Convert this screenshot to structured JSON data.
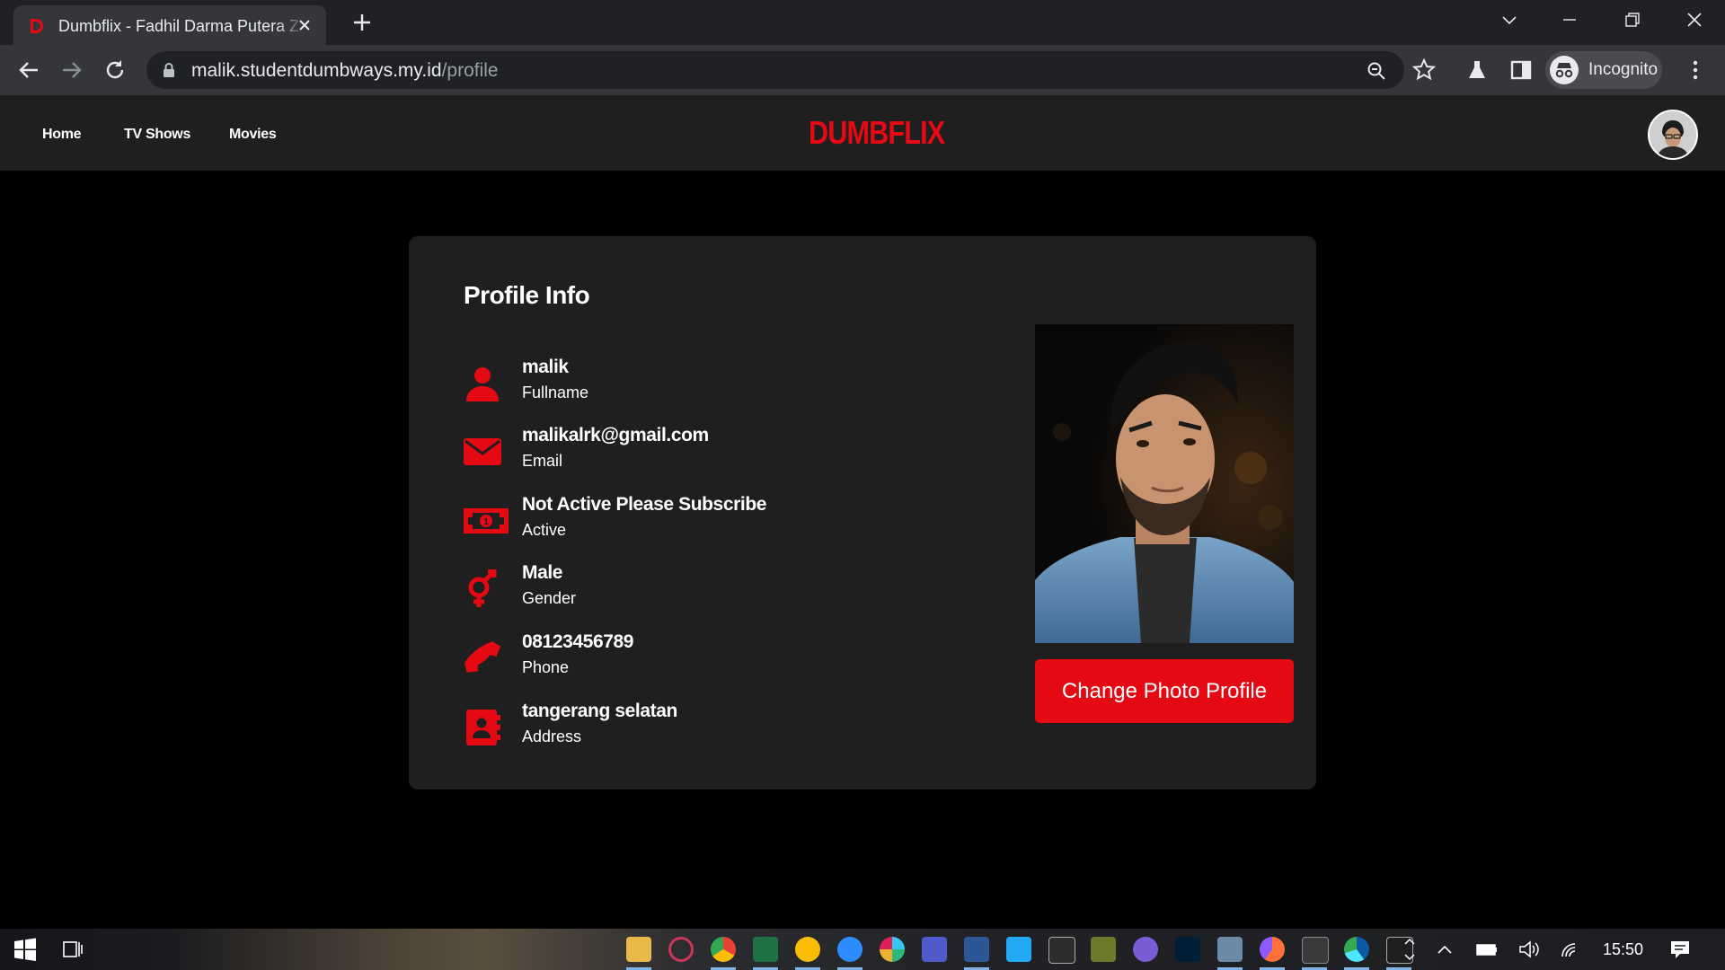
{
  "browser": {
    "tab_title": "Dumbflix - Fadhil Darma Putera Z",
    "url_host": "malik.studentdumbways.my.id",
    "url_path": "/profile",
    "profile_label": "Incognito"
  },
  "site": {
    "logo": "DUMBFLIX",
    "nav": [
      "Home",
      "TV Shows",
      "Movies"
    ],
    "brand_color": "#e50914"
  },
  "profile": {
    "title": "Profile Info",
    "fields": [
      {
        "icon": "user-icon",
        "value": "malik",
        "label": "Fullname"
      },
      {
        "icon": "envelope-icon",
        "value": "malikalrk@gmail.com",
        "label": "Email"
      },
      {
        "icon": "money-bill-icon",
        "value": "Not Active Please Subscribe",
        "label": "Active"
      },
      {
        "icon": "gender-icon",
        "value": "Male",
        "label": "Gender"
      },
      {
        "icon": "phone-icon",
        "value": "08123456789",
        "label": "Phone"
      },
      {
        "icon": "address-book-icon",
        "value": "tangerang selatan",
        "label": "Address"
      }
    ],
    "change_photo_label": "Change Photo Profile"
  },
  "taskbar": {
    "clock": "15:50"
  }
}
